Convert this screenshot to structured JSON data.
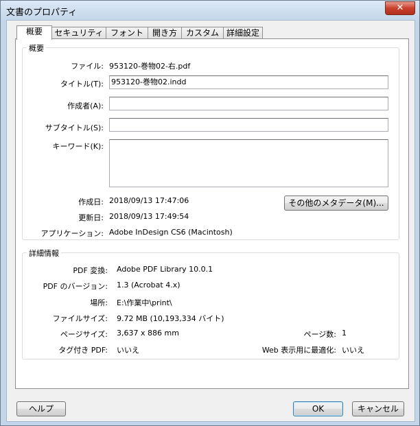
{
  "window": {
    "title": "文書のプロパティ",
    "close_glyph": "✕"
  },
  "tabs": [
    {
      "label": "概要"
    },
    {
      "label": "セキュリティ"
    },
    {
      "label": "フォント"
    },
    {
      "label": "開き方"
    },
    {
      "label": "カスタム"
    },
    {
      "label": "詳細設定"
    }
  ],
  "summary": {
    "group_title": "概要",
    "file_label": "ファイル:",
    "file_value": "953120-巻物02-右.pdf",
    "title_label": "タイトル(T):",
    "title_value": "953120-巻物02.indd",
    "author_label": "作成者(A):",
    "author_value": "",
    "subject_label": "サブタイトル(S):",
    "subject_value": "",
    "keywords_label": "キーワード(K):",
    "keywords_value": "",
    "created_label": "作成日:",
    "created_value": "2018/09/13 17:47:06",
    "modified_label": "更新日:",
    "modified_value": "2018/09/13 17:49:54",
    "application_label": "アプリケーション:",
    "application_value": "Adobe InDesign CS6 (Macintosh)",
    "metadata_button": "その他のメタデータ(M)..."
  },
  "details": {
    "group_title": "詳細情報",
    "producer_label": "PDF 変換:",
    "producer_value": "Adobe PDF Library 10.0.1",
    "version_label": "PDF のバージョン:",
    "version_value": "1.3 (Acrobat 4.x)",
    "location_label": "場所:",
    "location_value": "E:\\作業中\\print\\",
    "filesize_label": "ファイルサイズ:",
    "filesize_value": "9.72 MB (10,193,334 バイト)",
    "pagesize_label": "ページサイズ:",
    "pagesize_value": "3,637 x 886 mm",
    "pagecount_label": "ページ数:",
    "pagecount_value": "1",
    "tagged_label": "タグ付き PDF:",
    "tagged_value": "いいえ",
    "fastweb_label": "Web 表示用に最適化:",
    "fastweb_value": "いいえ"
  },
  "footer": {
    "help_button": "ヘルプ",
    "ok_button": "OK",
    "cancel_button": "キャンセル"
  }
}
